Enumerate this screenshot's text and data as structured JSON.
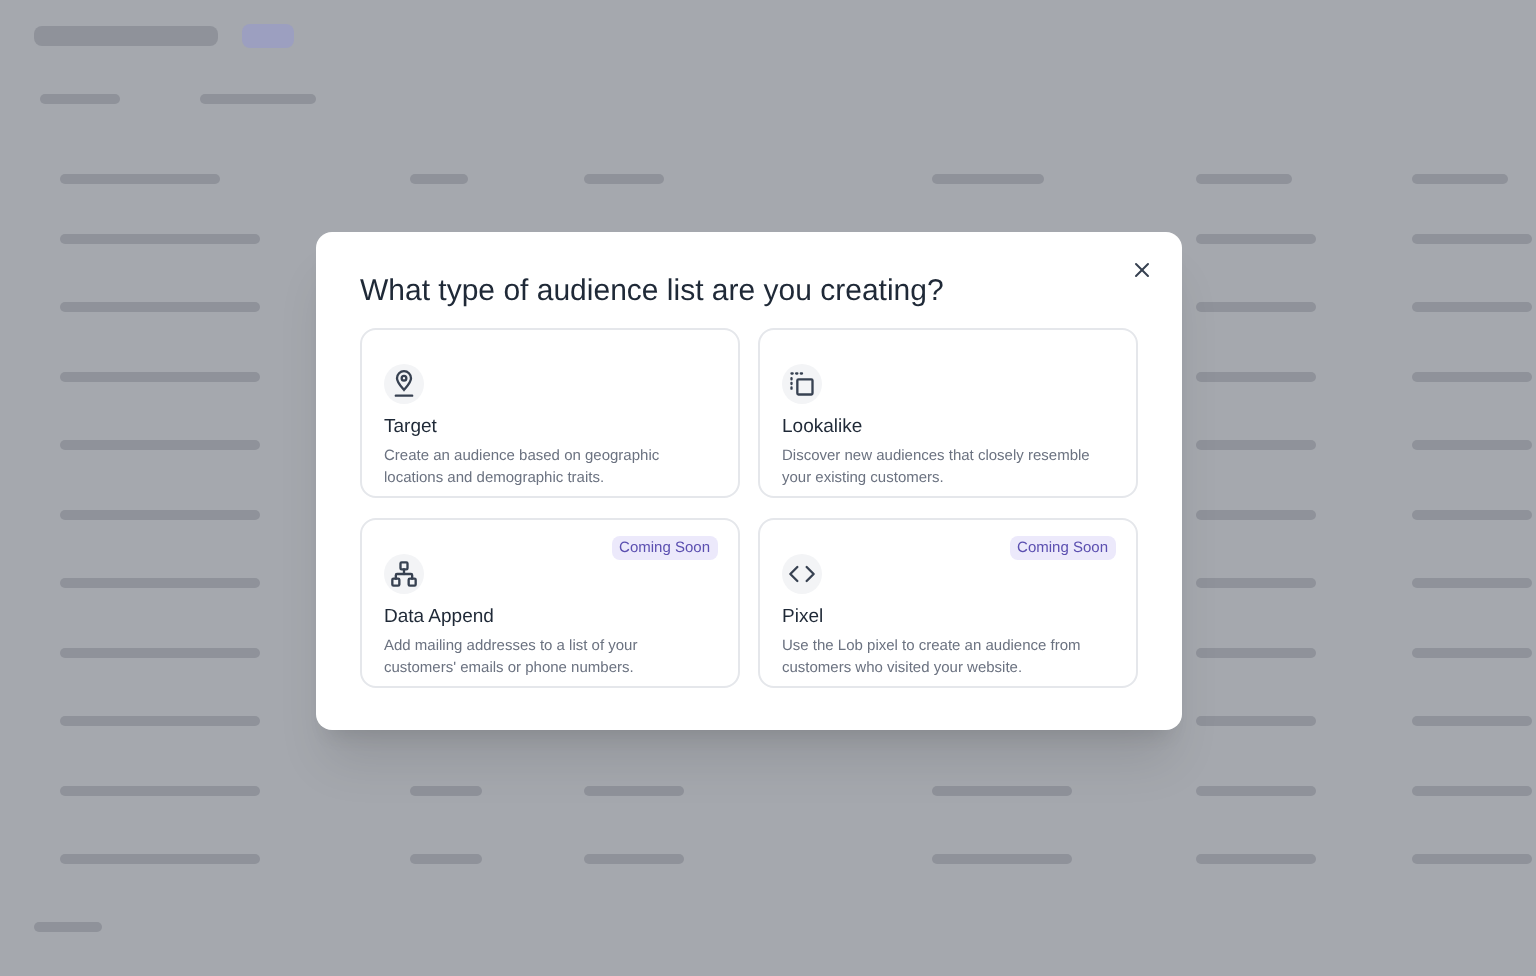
{
  "dialog": {
    "title": "What type of audience list are you creating?",
    "options": [
      {
        "kind": "target",
        "title": "Target",
        "description": "Create an audience based on geographic locations and demographic traits."
      },
      {
        "kind": "lookalike",
        "title": "Lookalike",
        "description": "Discover new audiences that closely resemble your existing customers."
      },
      {
        "kind": "data_append",
        "title": "Data Append",
        "description": "Add mailing addresses to a list of your customers' emails or phone numbers.",
        "badge": "Coming Soon"
      },
      {
        "kind": "pixel",
        "title": "Pixel",
        "description": "Use the Lob pixel to create an audience from customers who visited your website.",
        "badge": "Coming Soon"
      }
    ]
  }
}
